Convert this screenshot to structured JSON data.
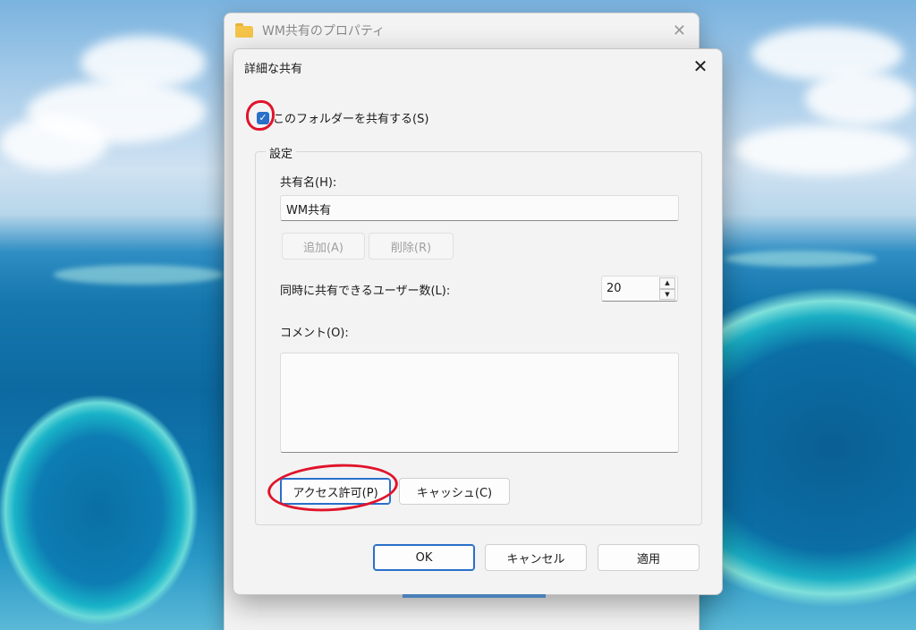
{
  "back_window": {
    "title": "WM共有のプロパティ",
    "close": "✕"
  },
  "dialog": {
    "title": "詳細な共有",
    "close": "✕",
    "share_checkbox": {
      "label": "このフォルダーを共有する(S)",
      "checked": true,
      "mark": "✓"
    },
    "settings": {
      "legend": "設定",
      "share_name_label": "共有名(H):",
      "share_name_value": "WM共有",
      "add_button": "追加(A)",
      "remove_button": "削除(R)",
      "user_limit_label": "同時に共有できるユーザー数(L):",
      "user_limit_value": "20",
      "spin_up": "▲",
      "spin_down": "▼",
      "comment_label": "コメント(O):",
      "comment_value": "",
      "permissions_button": "アクセス許可(P)",
      "caching_button": "キャッシュ(C)"
    },
    "footer": {
      "ok": "OK",
      "cancel": "キャンセル",
      "apply": "適用"
    }
  },
  "colors": {
    "accent": "#2a6fc9",
    "annotation_red": "#e0142b",
    "folder": "#f5c54a"
  }
}
